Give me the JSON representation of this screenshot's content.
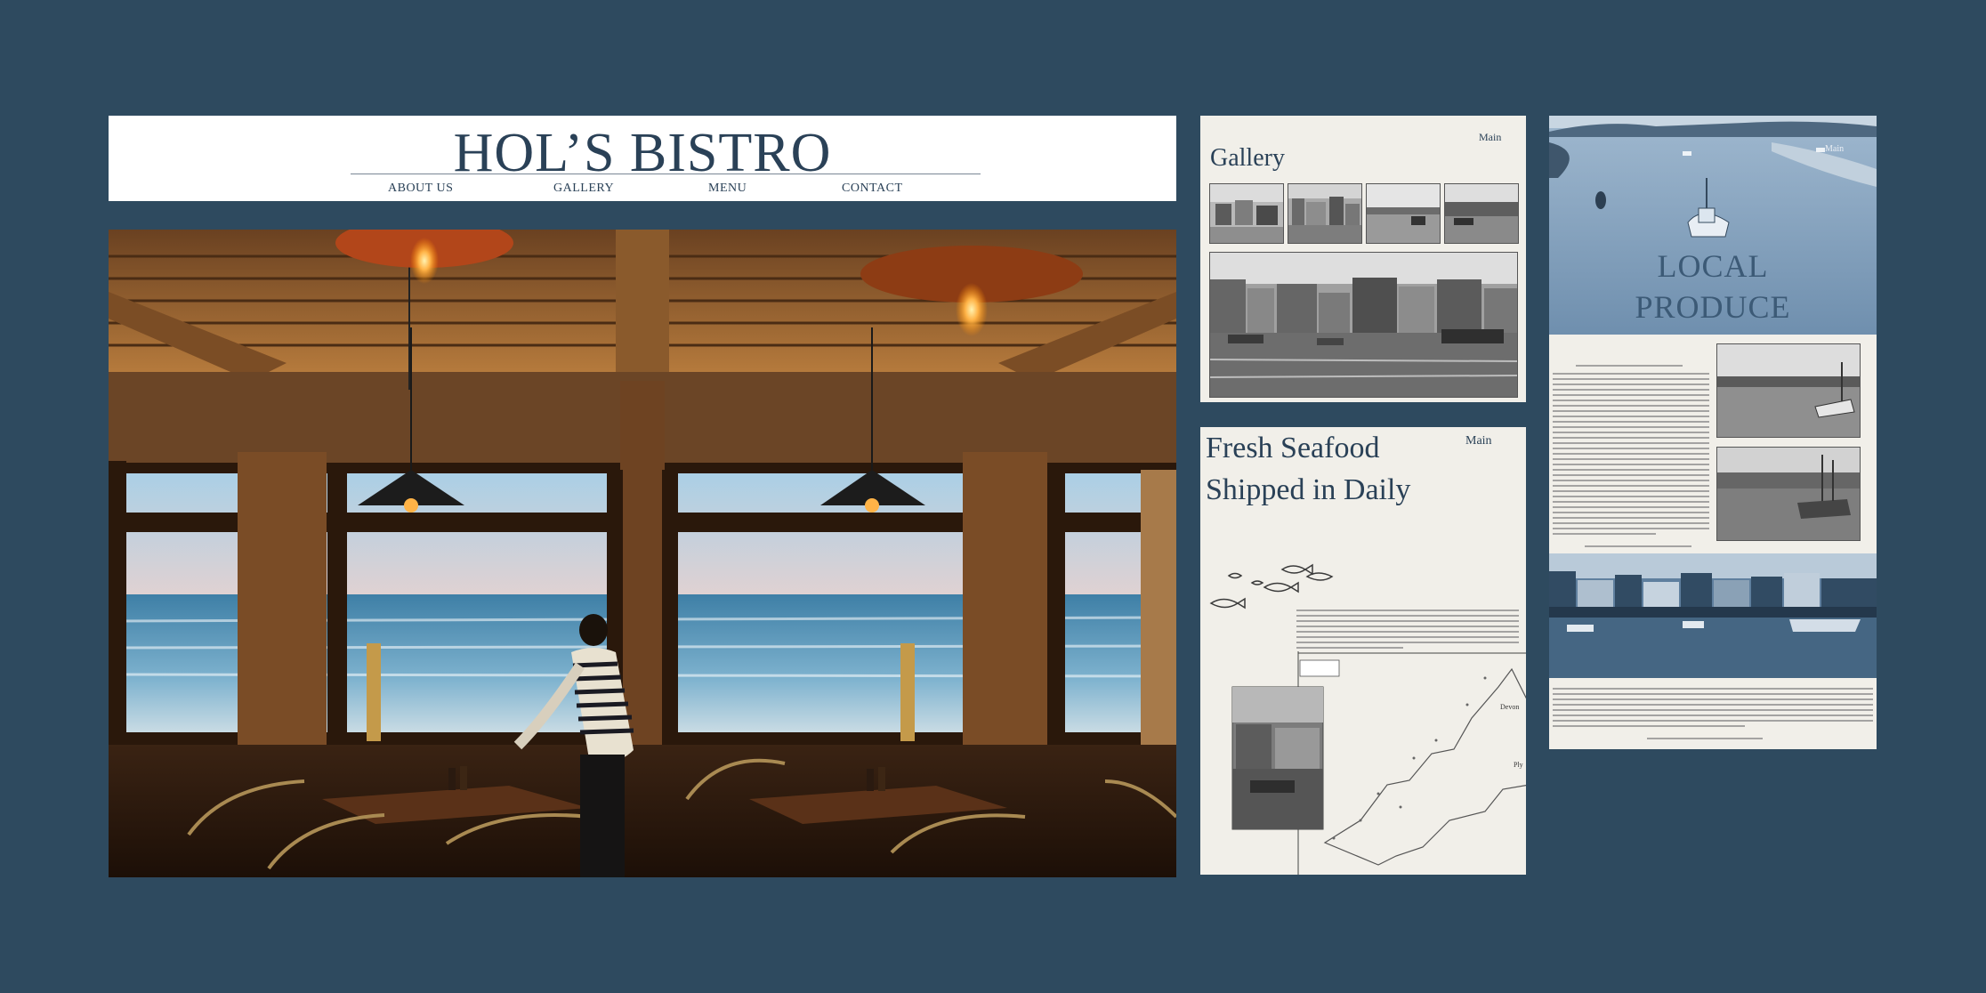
{
  "header": {
    "site_title": "HOL’S BISTRO",
    "nav": [
      "ABOUT US",
      "GALLERY",
      "MENU",
      "CONTACT"
    ]
  },
  "gallery_panel": {
    "title": "Gallery",
    "main_link": "Main"
  },
  "seafood_panel": {
    "title": "Fresh Seafood Shipped in Daily",
    "main_link": "Main",
    "map_labels": [
      "Devon",
      "Ply"
    ]
  },
  "produce_panel": {
    "title_line1": "LOCAL",
    "title_line2": "PRODUCE",
    "main_link": "Main"
  },
  "colors": {
    "background": "#2e4a5f",
    "header_bg": "#ffffff",
    "panel_bg": "#f1efe9",
    "title_navy": "#2a4157"
  }
}
